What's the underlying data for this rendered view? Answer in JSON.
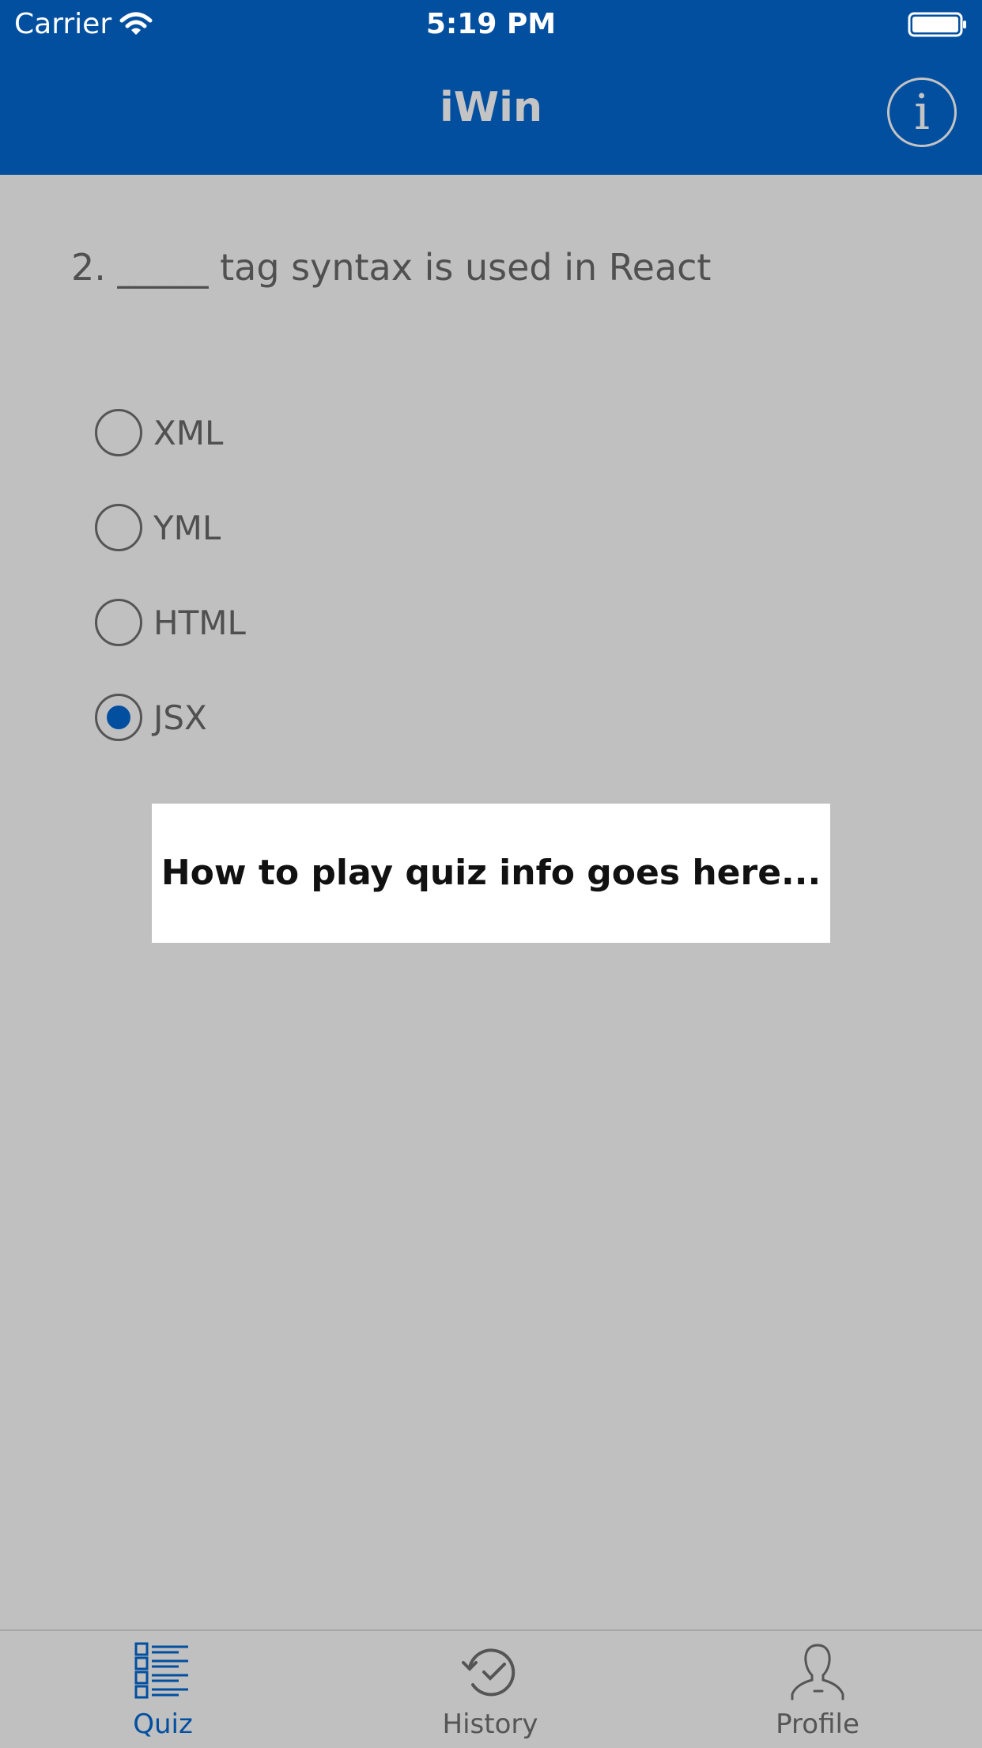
{
  "status_bar": {
    "carrier": "Carrier",
    "time": "5:19 PM"
  },
  "nav": {
    "title": "iWin",
    "info_icon": "info-icon",
    "info_glyph": "i"
  },
  "question": {
    "text": "2.  _____ tag syntax is used in React"
  },
  "options": [
    {
      "label": "XML",
      "selected": false
    },
    {
      "label": "YML",
      "selected": false
    },
    {
      "label": "HTML",
      "selected": false
    },
    {
      "label": "JSX",
      "selected": true
    }
  ],
  "popup": {
    "text": "How to play quiz info goes here..."
  },
  "tabs": [
    {
      "label": "Quiz",
      "icon": "list-icon",
      "active": true
    },
    {
      "label": "History",
      "icon": "history-icon",
      "active": false
    },
    {
      "label": "Profile",
      "icon": "profile-icon",
      "active": false
    }
  ],
  "colors": {
    "brand": "#024fa0",
    "background": "#c0c0c0",
    "text": "#505050"
  }
}
